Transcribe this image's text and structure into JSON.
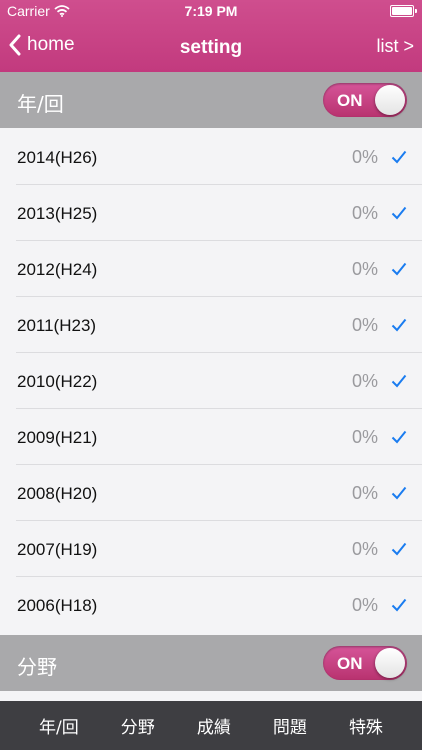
{
  "status_bar": {
    "carrier": "Carrier",
    "time": "7:19 PM"
  },
  "nav": {
    "back_label": "home",
    "title": "setting",
    "right_label": "list >"
  },
  "sections": [
    {
      "title": "年/回",
      "toggle_label": "ON",
      "toggle_on": true
    },
    {
      "title": "分野",
      "toggle_label": "ON",
      "toggle_on": true
    }
  ],
  "years": [
    {
      "label": "2014(H26)",
      "percent": "0%",
      "checked": true
    },
    {
      "label": "2013(H25)",
      "percent": "0%",
      "checked": true
    },
    {
      "label": "2012(H24)",
      "percent": "0%",
      "checked": true
    },
    {
      "label": "2011(H23)",
      "percent": "0%",
      "checked": true
    },
    {
      "label": "2010(H22)",
      "percent": "0%",
      "checked": true
    },
    {
      "label": "2009(H21)",
      "percent": "0%",
      "checked": true
    },
    {
      "label": "2008(H20)",
      "percent": "0%",
      "checked": true
    },
    {
      "label": "2007(H19)",
      "percent": "0%",
      "checked": true
    },
    {
      "label": "2006(H18)",
      "percent": "0%",
      "checked": true
    }
  ],
  "tabs": [
    "年/回",
    "分野",
    "成績",
    "問題",
    "特殊"
  ],
  "colors": {
    "accent": "#c94285",
    "section": "#a9a9ab",
    "tab_bar": "#3e3e42",
    "check": "#1a7cf0"
  },
  "icons": {
    "wifi": "wifi-icon",
    "battery": "battery-icon",
    "back": "chevron-left-icon",
    "check": "checkmark-icon"
  }
}
